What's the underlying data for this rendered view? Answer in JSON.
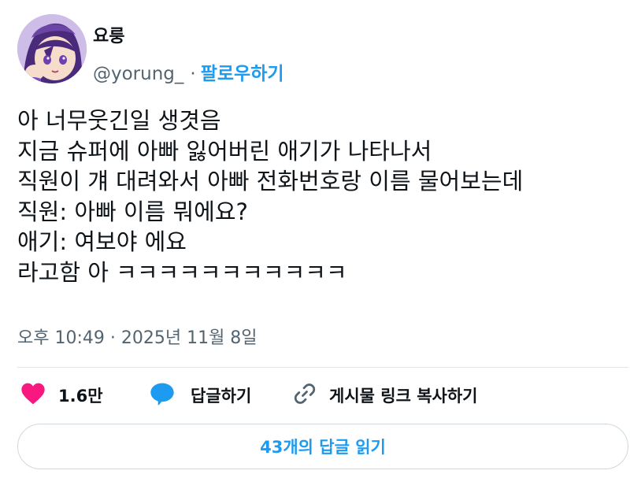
{
  "author": {
    "display_name": "요룽",
    "handle": "@yorung_",
    "separator": "·",
    "follow_label": "팔로우하기"
  },
  "tweet": {
    "lines": [
      "아 너무웃긴일 생겻음",
      "지금 슈퍼에 아빠 잃어버린 애기가 나타나서",
      "직원이 걔 대려와서 아빠 전화번호랑 이름 물어보는데",
      "직원: 아빠 이름 뭐에요?",
      "애기: 여보야 에요",
      "라고함 아 ㅋㅋㅋㅋㅋㅋㅋㅋㅋㅋㅋ"
    ],
    "timestamp": "오후 10:49 · 2025년 11월 8일"
  },
  "actions": {
    "like_count": "1.6만",
    "reply_label": "답글하기",
    "copy_link_label": "게시물 링크 복사하기"
  },
  "read_replies_label": "43개의 답글 읽기",
  "colors": {
    "accent": "#1d9bf0",
    "like": "#f91880",
    "text": "#0f1419",
    "muted": "#536471",
    "border": "#cfd9de"
  },
  "icons": {
    "like": "heart-icon",
    "reply": "speech-bubble-icon",
    "copy_link": "link-icon"
  }
}
